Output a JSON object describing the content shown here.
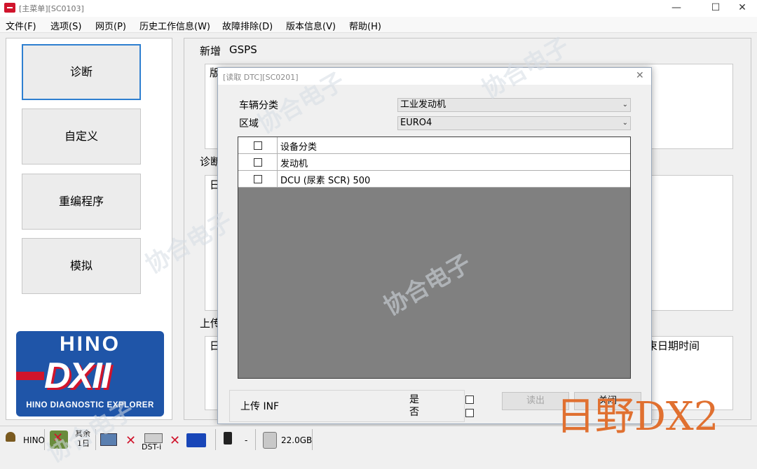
{
  "window": {
    "title": "[主菜单][SC0103]",
    "minimize_glyph": "—",
    "maximize_glyph": "☐",
    "close_glyph": "✕"
  },
  "menu": [
    "文件(F)",
    "选项(S)",
    "网页(P)",
    "历史工作信息(W)",
    "故障排除(D)",
    "版本信息(V)",
    "帮助(H)"
  ],
  "nav": {
    "buttons": [
      "诊断",
      "自定义",
      "重编程序",
      "模拟"
    ],
    "active_index": 0
  },
  "logo": {
    "brand": "HINO",
    "product": "DXII",
    "subtitle": "HINO DIAGNOSTIC EXPLORER"
  },
  "background": {
    "title_prefix": "新增",
    "title_value": "GSPS",
    "section_fragment_1": "版本目版",
    "section_label_2": "诊断",
    "box2_fragment": "日",
    "section_label_3": "上传",
    "box3_fragment": "日",
    "box3_right_text": "结束日期时间"
  },
  "dialog": {
    "title": "[读取 DTC][SC0201]",
    "close_glyph": "✕",
    "vehicle_category_label": "车辆分类",
    "vehicle_category_value": "工业发动机",
    "region_label": "区域",
    "region_value": "EURO4",
    "table": {
      "header": "设备分类",
      "rows": [
        "发动机",
        "DCU (尿素 SCR) 500"
      ]
    },
    "upload_label": "上传 INF",
    "yes_label": "是",
    "no_label": "否",
    "read_button": "读出",
    "close_button": "关闭"
  },
  "statusbar": {
    "user": "HINO",
    "remaining_label": "其余",
    "remaining_value": "1日",
    "device": "DST-i",
    "battery_text": "-",
    "disk": "22.0GB"
  },
  "watermark": {
    "text": "协合电子",
    "overlay": "日野DX2"
  },
  "colors": {
    "accent_blue": "#2e7fd0",
    "hino_blue": "#1f55a8",
    "hino_red": "#d0142c",
    "overlay_orange": "#e07030",
    "table_bg": "#808080"
  }
}
